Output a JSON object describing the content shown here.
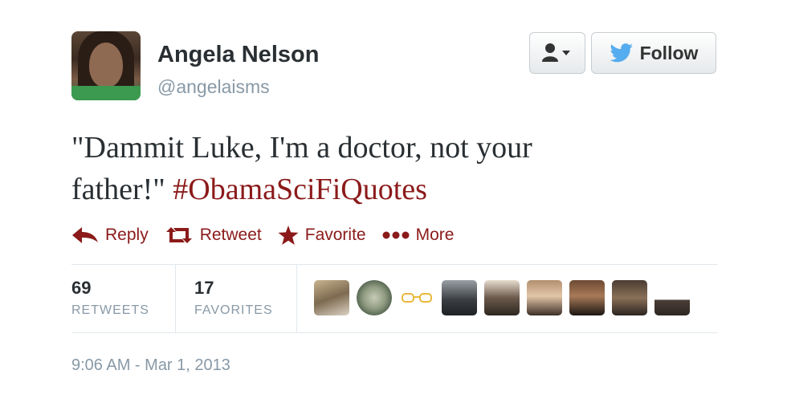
{
  "user": {
    "fullname": "Angela Nelson",
    "username": "@angelaisms"
  },
  "header": {
    "follow_label": "Follow",
    "user_dropdown_icon": "user-caret-icon",
    "follow_icon": "twitter-bird-icon"
  },
  "tweet": {
    "text_line1": "\"Dammit Luke, I'm a doctor, not your",
    "text_line2": "father!\"",
    "hashtag": "#ObamaSciFiQuotes"
  },
  "actions": {
    "reply": "Reply",
    "retweet": "Retweet",
    "favorite": "Favorite",
    "more": "More"
  },
  "stats": {
    "retweets_count": "69",
    "retweets_label": "RETWEETS",
    "favorites_count": "17",
    "favorites_label": "FAVORITES"
  },
  "timestamp": "9:06 AM - Mar 1, 2013",
  "colors": {
    "link": "#8b1a1a",
    "muted": "#8899a6",
    "twitter_blue": "#55acee"
  }
}
